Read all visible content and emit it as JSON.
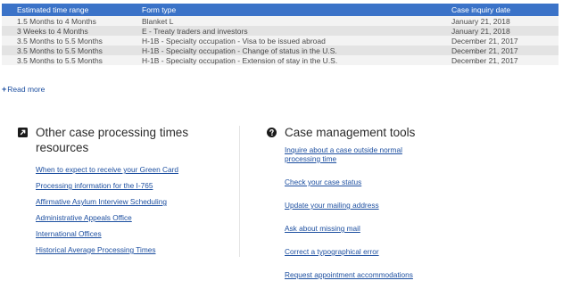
{
  "table": {
    "headers": [
      "Estimated time range",
      "Form type",
      "Case inquiry date"
    ],
    "rows": [
      [
        "1.5 Months to 4 Months",
        "Blanket L",
        "January 21, 2018"
      ],
      [
        "3 Weeks to 4 Months",
        "E - Treaty traders and investors",
        "January 21, 2018"
      ],
      [
        "3.5 Months to 5.5 Months",
        "H-1B - Specialty occupation - Visa to be issued abroad",
        "December 21, 2017"
      ],
      [
        "3.5 Months to 5.5 Months",
        "H-1B - Specialty occupation - Change of status in the U.S.",
        "December 21, 2017"
      ],
      [
        "3.5 Months to 5.5 Months",
        "H-1B - Specialty occupation - Extension of stay in the U.S.",
        "December 21, 2017"
      ]
    ],
    "read_more_label": "Read more",
    "read_more_icon": "plus-icon"
  },
  "other_resources": {
    "icon": "external-link-icon",
    "title_line1": "Other case processing times",
    "title_line2": "resources",
    "links": [
      "When to expect to receive your Green Card",
      "Processing information for the I-765",
      "Affirmative Asylum Interview Scheduling",
      "Administrative Appeals Office",
      "International Offices",
      "Historical Average Processing Times"
    ]
  },
  "case_tools": {
    "icon": "question-circle-icon",
    "title": "Case management tools",
    "links": [
      "Inquire about a case outside normal processing time",
      "Check your case status",
      "Update your mailing address",
      "Ask about missing mail",
      "Correct a typographical error",
      "Request appointment accommodations"
    ]
  },
  "colors": {
    "header_bg": "#3b73c8",
    "link": "#1d4fa0",
    "row_light": "#f3f3f3",
    "row_dark": "#e3e3e3"
  }
}
